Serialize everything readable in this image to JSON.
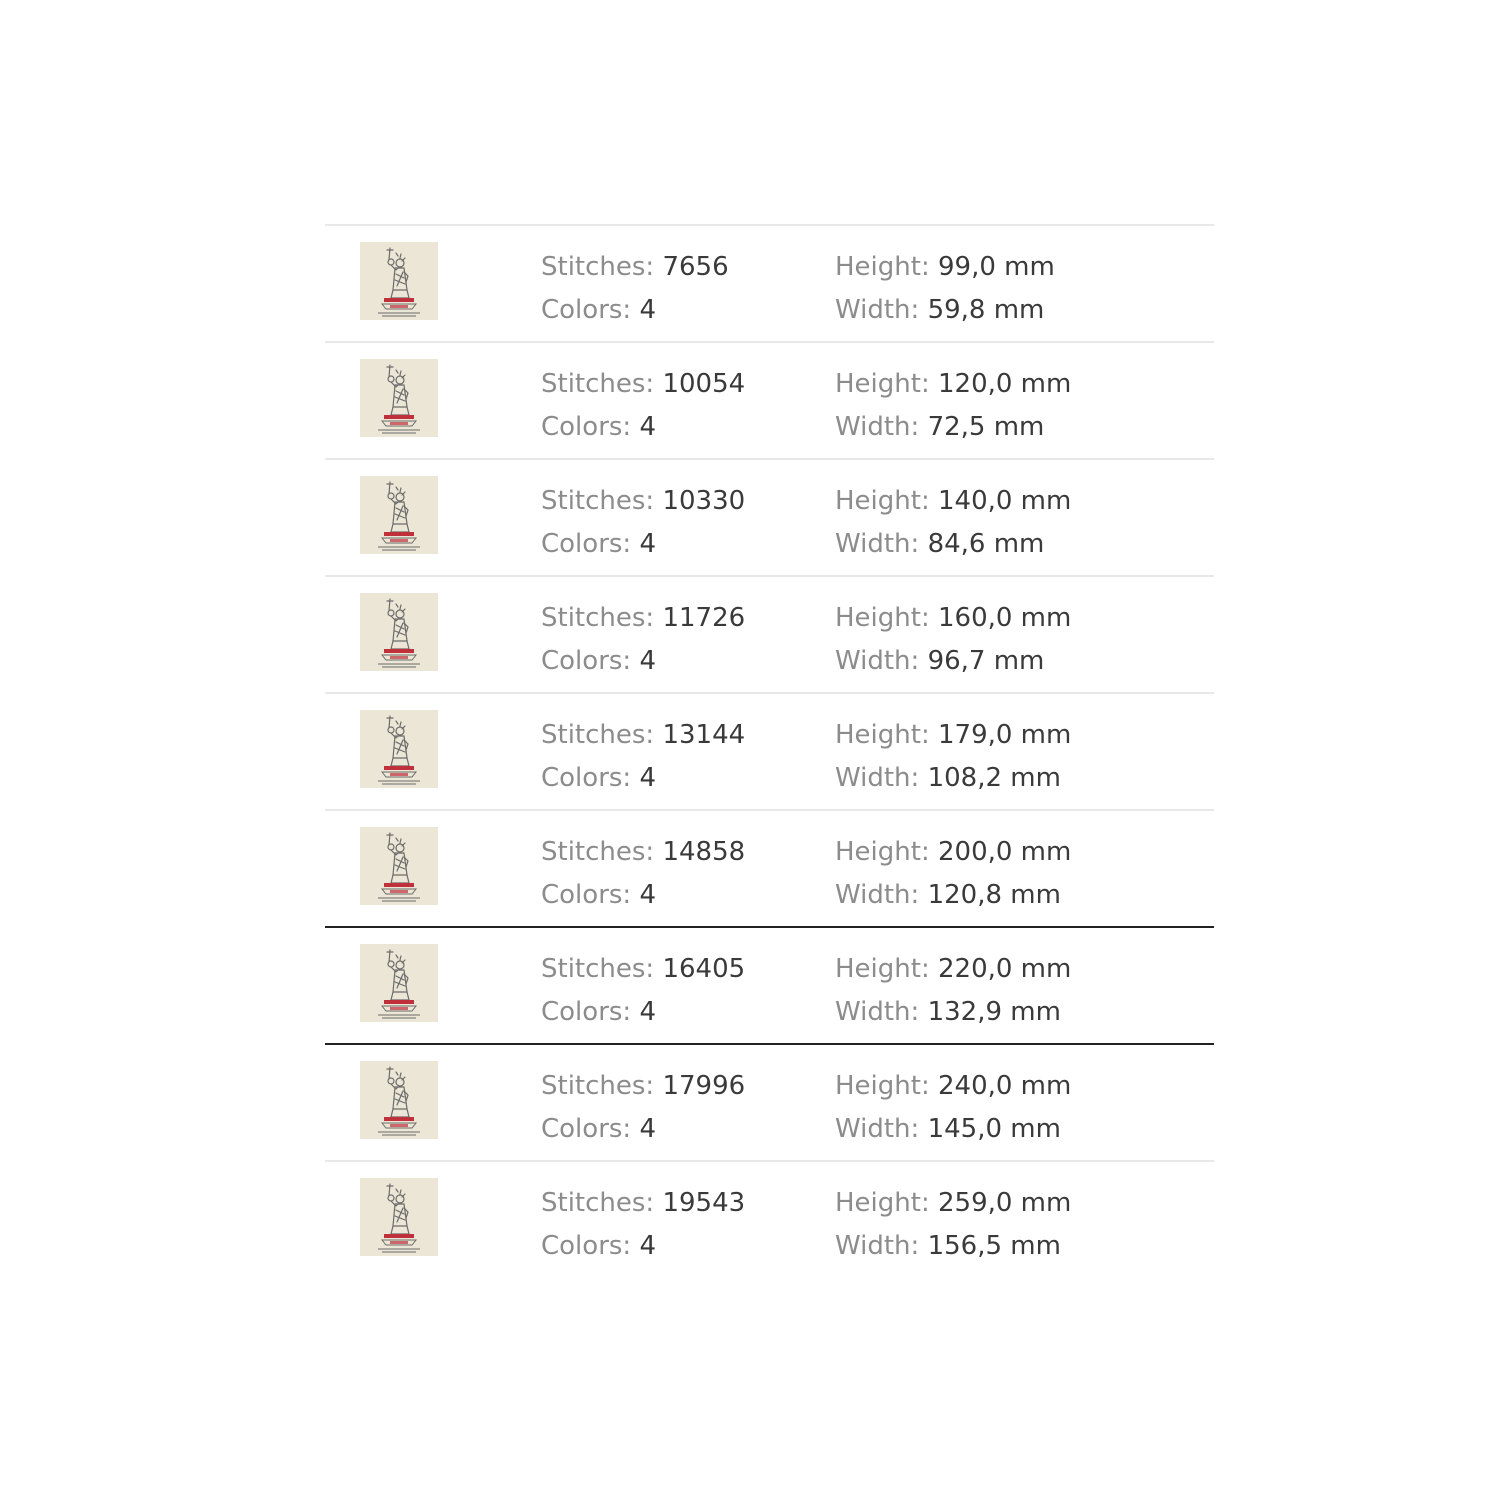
{
  "labels": {
    "stitches": "Stitches:",
    "colors": "Colors:",
    "height": "Height:",
    "width": "Width:"
  },
  "thumbnail": {
    "icon": "statue-of-liberty-embroidery-icon",
    "background_color": "#ebe6d6",
    "stitch_color": "#6b6b6b",
    "accent_color": "#c0303a"
  },
  "sizes": [
    {
      "stitches": "7656",
      "colors": "4",
      "height": "99,0 mm",
      "width": "59,8 mm"
    },
    {
      "stitches": "10054",
      "colors": "4",
      "height": "120,0 mm",
      "width": "72,5 mm"
    },
    {
      "stitches": "10330",
      "colors": "4",
      "height": "140,0 mm",
      "width": "84,6 mm"
    },
    {
      "stitches": "11726",
      "colors": "4",
      "height": "160,0 mm",
      "width": "96,7 mm"
    },
    {
      "stitches": "13144",
      "colors": "4",
      "height": "179,0 mm",
      "width": "108,2 mm"
    },
    {
      "stitches": "14858",
      "colors": "4",
      "height": "200,0 mm",
      "width": "120,8 mm"
    },
    {
      "stitches": "16405",
      "colors": "4",
      "height": "220,0 mm",
      "width": "132,9 mm"
    },
    {
      "stitches": "17996",
      "colors": "4",
      "height": "240,0 mm",
      "width": "145,0 mm"
    },
    {
      "stitches": "19543",
      "colors": "4",
      "height": "259,0 mm",
      "width": "156,5 mm"
    }
  ]
}
